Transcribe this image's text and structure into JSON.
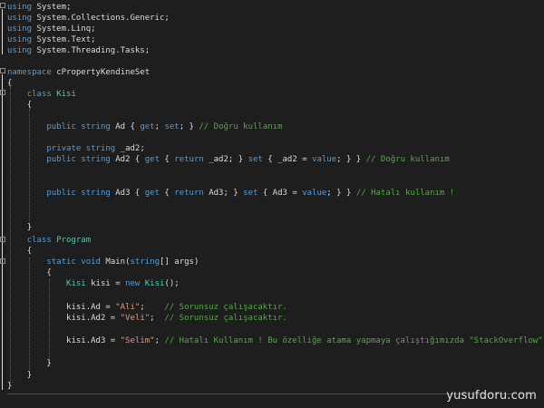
{
  "code": {
    "using_lines": [
      {
        "kw": "using",
        "ns": " System;"
      },
      {
        "kw": "using",
        "ns": " System.Collections.Generic;"
      },
      {
        "kw": "using",
        "ns": " System.Linq;"
      },
      {
        "kw": "using",
        "ns": " System.Text;"
      },
      {
        "kw": "using",
        "ns": " System.Threading.Tasks;"
      }
    ],
    "namespace_kw": "namespace",
    "namespace_name": " cPropertyKendineSet",
    "open_brace": "{",
    "close_brace": "}",
    "class_kw": "class",
    "class1_name": "Kisi",
    "class2_name": "Program",
    "kw_public": "public",
    "kw_private": "private",
    "kw_string": "string",
    "kw_get": "get",
    "kw_set": "set",
    "kw_return": "return",
    "kw_value": "value",
    "kw_static": "static",
    "kw_void": "void",
    "kw_new": "new",
    "prop_ad": " Ad { ",
    "prop_ad_mid": "; ",
    "prop_ad_end": "; } ",
    "comment_ad": "// Doğru kullanım",
    "field_ad2": " _ad2;",
    "prop_ad2_a": " Ad2 { ",
    "prop_ad2_b": " { ",
    "prop_ad2_c": " _ad2; } ",
    "prop_ad2_d": " { _ad2 = ",
    "prop_ad2_e": "; } } ",
    "comment_ad2": "// Doğru kullanım",
    "prop_ad3_a": " Ad3 { ",
    "prop_ad3_b": " { ",
    "prop_ad3_c": " Ad3; } ",
    "prop_ad3_d": " { Ad3 = ",
    "prop_ad3_e": "; } } ",
    "comment_ad3": "// Hatalı kullanım !",
    "main_a": " Main(",
    "main_b": "[] args)",
    "kisi_decl_a": " kisi = ",
    "kisi_decl_b": " Kisi",
    "kisi_decl_c": "();",
    "assign1_a": "kisi.Ad = ",
    "assign1_str": "\"Ali\"",
    "assign1_b": ";    ",
    "comment_a1": "// Sorunsuz çalışacaktır.",
    "assign2_a": "kisi.Ad2 = ",
    "assign2_str": "\"Veli\"",
    "assign2_b": ";  ",
    "comment_a2": "// Sorunsuz çalışacaktır.",
    "assign3_a": "kisi.Ad3 = ",
    "assign3_str": "\"Selim\"",
    "assign3_b": "; ",
    "comment_a3": "// Hatalı Kullanım ! Bu özelliğe atama yapmaya çalıştığımızda \"StackOverflow\""
  },
  "watermark": "yusufdoru.com",
  "colors": {
    "background": "#1e1e1e",
    "keyword": "#569cd6",
    "type": "#4ec9b0",
    "string": "#d69d85",
    "comment": "#57a64a",
    "text": "#dcdcdc"
  }
}
